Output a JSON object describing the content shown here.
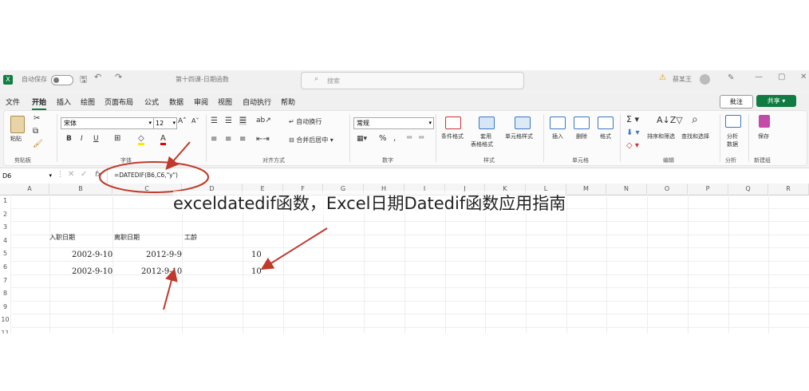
{
  "title_bar": {
    "autosave_label": "自动保存",
    "file_name": "第十四课-日期函数",
    "search_placeholder": "搜索",
    "user_name": "蔡某王"
  },
  "menu": {
    "items": [
      "文件",
      "开始",
      "插入",
      "绘图",
      "页面布局",
      "公式",
      "数据",
      "审阅",
      "视图",
      "自动执行",
      "帮助"
    ],
    "active": "开始",
    "comment_label": "批注",
    "share_label": "共享"
  },
  "ribbon": {
    "clipboard": {
      "paste": "粘贴",
      "group": "剪贴板"
    },
    "font": {
      "name": "宋体",
      "size": "12",
      "bold": "B",
      "italic": "I",
      "underline": "U",
      "group": "字体"
    },
    "alignment": {
      "wrap": "自动换行",
      "merge": "合并后居中",
      "group": "对齐方式"
    },
    "number": {
      "format": "常规",
      "percent": "%",
      "comma": ",",
      "group": "数字"
    },
    "styles": {
      "conditional": "条件格式",
      "table_line1": "套用",
      "table_line2": "表格格式",
      "cell_styles": "单元格样式",
      "group": "样式"
    },
    "cells": {
      "insert": "插入",
      "delete": "删除",
      "format": "格式",
      "group": "单元格"
    },
    "editing": {
      "sort": "排序和筛选",
      "find": "查找和选择",
      "group": "编辑"
    },
    "analysis": {
      "analyze_line1": "分析",
      "analyze_line2": "数据",
      "group": "分析"
    },
    "save": {
      "label": "保存",
      "group": "新建组"
    }
  },
  "formula_bar": {
    "name_box": "D6",
    "fx": "fx",
    "formula": "=DATEDIF(B6,C6,\"y\")"
  },
  "sheet": {
    "columns": [
      "A",
      "B",
      "C",
      "D",
      "E",
      "F",
      "G",
      "H",
      "I",
      "J",
      "K",
      "L",
      "M",
      "N",
      "O",
      "P",
      "Q",
      "R"
    ],
    "rows": [
      "1",
      "2",
      "3",
      "4",
      "5",
      "6",
      "7",
      "8",
      "9",
      "10",
      "11"
    ],
    "headers": {
      "b4": "入职日期",
      "c4": "离职日期",
      "d4": "工龄"
    },
    "data": [
      {
        "start": "2002-9-10",
        "end": "2012-9-9",
        "years": "10"
      },
      {
        "start": "2002-9-10",
        "end": "2012-9-10",
        "years": "10"
      }
    ]
  },
  "caption": "exceldatedif函数，Excel日期Datedif函数应用指南",
  "colors": {
    "excel_green": "#107c41",
    "annotation_red": "#c0392b"
  }
}
